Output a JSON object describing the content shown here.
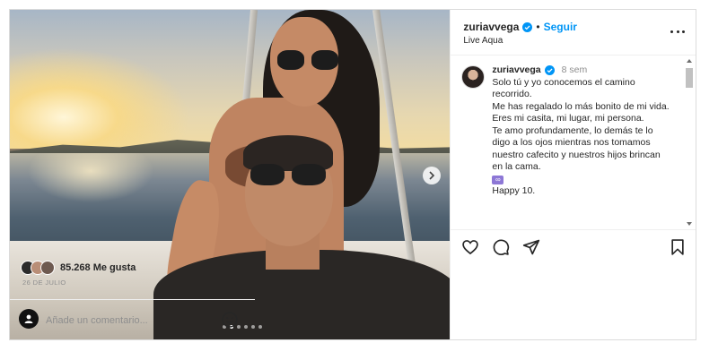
{
  "post": {
    "author": "zuriavvega",
    "follow_label": "Seguir",
    "separator": "•",
    "location": "Live Aqua",
    "caption": {
      "username": "zuriavvega",
      "time": "8 sem",
      "lines": "Solo tú y yo conocemos el camino recorrido.\nMe has regalado lo más bonito de mi vida.\nEres mi casita, mi lugar, mi persona.\nTe amo profundamente, lo demás te lo digo a los ojos mientras nos tomamos nuestro cafecito y nuestros hijos brincan en la cama.",
      "emoji": "∞",
      "last_line": "Happy 10."
    },
    "likes": "85.268 Me gusta",
    "date": "26 DE JULIO",
    "comment_placeholder": "Añade un comentario...",
    "carousel": {
      "total": 6,
      "active": 1
    }
  },
  "icons": {
    "verified": "verified-badge-icon",
    "more": "more-options-icon",
    "like": "heart-icon",
    "comment": "comment-icon",
    "share": "send-icon",
    "save": "bookmark-icon",
    "emoji": "emoji-icon",
    "next": "chevron-right-icon",
    "tag": "user-tag-icon"
  },
  "colors": {
    "accent": "#0095f6",
    "text": "#262626",
    "muted": "#8e8e8e"
  }
}
